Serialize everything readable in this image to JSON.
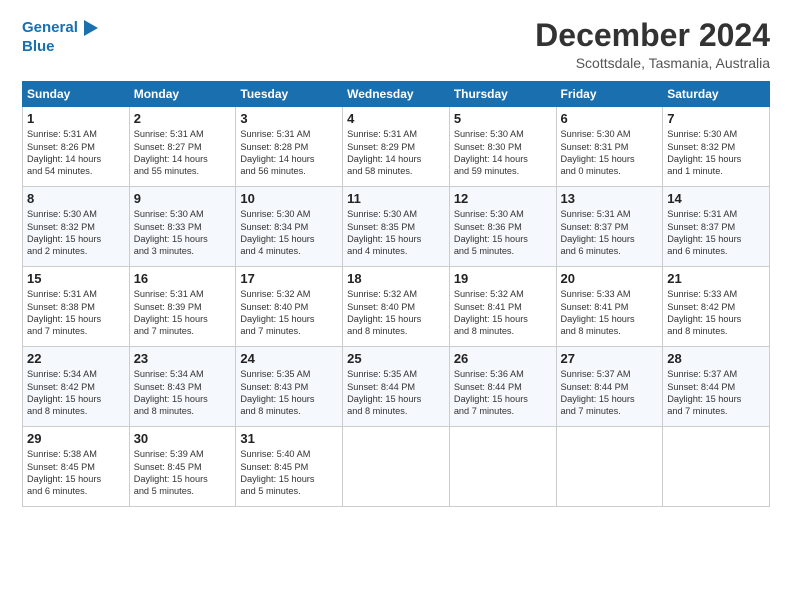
{
  "logo": {
    "line1": "General",
    "line2": "Blue"
  },
  "header": {
    "month": "December 2024",
    "location": "Scottsdale, Tasmania, Australia"
  },
  "weekdays": [
    "Sunday",
    "Monday",
    "Tuesday",
    "Wednesday",
    "Thursday",
    "Friday",
    "Saturday"
  ],
  "weeks": [
    [
      {
        "day": "1",
        "lines": [
          "Sunrise: 5:31 AM",
          "Sunset: 8:26 PM",
          "Daylight: 14 hours",
          "and 54 minutes."
        ]
      },
      {
        "day": "2",
        "lines": [
          "Sunrise: 5:31 AM",
          "Sunset: 8:27 PM",
          "Daylight: 14 hours",
          "and 55 minutes."
        ]
      },
      {
        "day": "3",
        "lines": [
          "Sunrise: 5:31 AM",
          "Sunset: 8:28 PM",
          "Daylight: 14 hours",
          "and 56 minutes."
        ]
      },
      {
        "day": "4",
        "lines": [
          "Sunrise: 5:31 AM",
          "Sunset: 8:29 PM",
          "Daylight: 14 hours",
          "and 58 minutes."
        ]
      },
      {
        "day": "5",
        "lines": [
          "Sunrise: 5:30 AM",
          "Sunset: 8:30 PM",
          "Daylight: 14 hours",
          "and 59 minutes."
        ]
      },
      {
        "day": "6",
        "lines": [
          "Sunrise: 5:30 AM",
          "Sunset: 8:31 PM",
          "Daylight: 15 hours",
          "and 0 minutes."
        ]
      },
      {
        "day": "7",
        "lines": [
          "Sunrise: 5:30 AM",
          "Sunset: 8:32 PM",
          "Daylight: 15 hours",
          "and 1 minute."
        ]
      }
    ],
    [
      {
        "day": "8",
        "lines": [
          "Sunrise: 5:30 AM",
          "Sunset: 8:32 PM",
          "Daylight: 15 hours",
          "and 2 minutes."
        ]
      },
      {
        "day": "9",
        "lines": [
          "Sunrise: 5:30 AM",
          "Sunset: 8:33 PM",
          "Daylight: 15 hours",
          "and 3 minutes."
        ]
      },
      {
        "day": "10",
        "lines": [
          "Sunrise: 5:30 AM",
          "Sunset: 8:34 PM",
          "Daylight: 15 hours",
          "and 4 minutes."
        ]
      },
      {
        "day": "11",
        "lines": [
          "Sunrise: 5:30 AM",
          "Sunset: 8:35 PM",
          "Daylight: 15 hours",
          "and 4 minutes."
        ]
      },
      {
        "day": "12",
        "lines": [
          "Sunrise: 5:30 AM",
          "Sunset: 8:36 PM",
          "Daylight: 15 hours",
          "and 5 minutes."
        ]
      },
      {
        "day": "13",
        "lines": [
          "Sunrise: 5:31 AM",
          "Sunset: 8:37 PM",
          "Daylight: 15 hours",
          "and 6 minutes."
        ]
      },
      {
        "day": "14",
        "lines": [
          "Sunrise: 5:31 AM",
          "Sunset: 8:37 PM",
          "Daylight: 15 hours",
          "and 6 minutes."
        ]
      }
    ],
    [
      {
        "day": "15",
        "lines": [
          "Sunrise: 5:31 AM",
          "Sunset: 8:38 PM",
          "Daylight: 15 hours",
          "and 7 minutes."
        ]
      },
      {
        "day": "16",
        "lines": [
          "Sunrise: 5:31 AM",
          "Sunset: 8:39 PM",
          "Daylight: 15 hours",
          "and 7 minutes."
        ]
      },
      {
        "day": "17",
        "lines": [
          "Sunrise: 5:32 AM",
          "Sunset: 8:40 PM",
          "Daylight: 15 hours",
          "and 7 minutes."
        ]
      },
      {
        "day": "18",
        "lines": [
          "Sunrise: 5:32 AM",
          "Sunset: 8:40 PM",
          "Daylight: 15 hours",
          "and 8 minutes."
        ]
      },
      {
        "day": "19",
        "lines": [
          "Sunrise: 5:32 AM",
          "Sunset: 8:41 PM",
          "Daylight: 15 hours",
          "and 8 minutes."
        ]
      },
      {
        "day": "20",
        "lines": [
          "Sunrise: 5:33 AM",
          "Sunset: 8:41 PM",
          "Daylight: 15 hours",
          "and 8 minutes."
        ]
      },
      {
        "day": "21",
        "lines": [
          "Sunrise: 5:33 AM",
          "Sunset: 8:42 PM",
          "Daylight: 15 hours",
          "and 8 minutes."
        ]
      }
    ],
    [
      {
        "day": "22",
        "lines": [
          "Sunrise: 5:34 AM",
          "Sunset: 8:42 PM",
          "Daylight: 15 hours",
          "and 8 minutes."
        ]
      },
      {
        "day": "23",
        "lines": [
          "Sunrise: 5:34 AM",
          "Sunset: 8:43 PM",
          "Daylight: 15 hours",
          "and 8 minutes."
        ]
      },
      {
        "day": "24",
        "lines": [
          "Sunrise: 5:35 AM",
          "Sunset: 8:43 PM",
          "Daylight: 15 hours",
          "and 8 minutes."
        ]
      },
      {
        "day": "25",
        "lines": [
          "Sunrise: 5:35 AM",
          "Sunset: 8:44 PM",
          "Daylight: 15 hours",
          "and 8 minutes."
        ]
      },
      {
        "day": "26",
        "lines": [
          "Sunrise: 5:36 AM",
          "Sunset: 8:44 PM",
          "Daylight: 15 hours",
          "and 7 minutes."
        ]
      },
      {
        "day": "27",
        "lines": [
          "Sunrise: 5:37 AM",
          "Sunset: 8:44 PM",
          "Daylight: 15 hours",
          "and 7 minutes."
        ]
      },
      {
        "day": "28",
        "lines": [
          "Sunrise: 5:37 AM",
          "Sunset: 8:44 PM",
          "Daylight: 15 hours",
          "and 7 minutes."
        ]
      }
    ],
    [
      {
        "day": "29",
        "lines": [
          "Sunrise: 5:38 AM",
          "Sunset: 8:45 PM",
          "Daylight: 15 hours",
          "and 6 minutes."
        ]
      },
      {
        "day": "30",
        "lines": [
          "Sunrise: 5:39 AM",
          "Sunset: 8:45 PM",
          "Daylight: 15 hours",
          "and 5 minutes."
        ]
      },
      {
        "day": "31",
        "lines": [
          "Sunrise: 5:40 AM",
          "Sunset: 8:45 PM",
          "Daylight: 15 hours",
          "and 5 minutes."
        ]
      },
      null,
      null,
      null,
      null
    ]
  ]
}
